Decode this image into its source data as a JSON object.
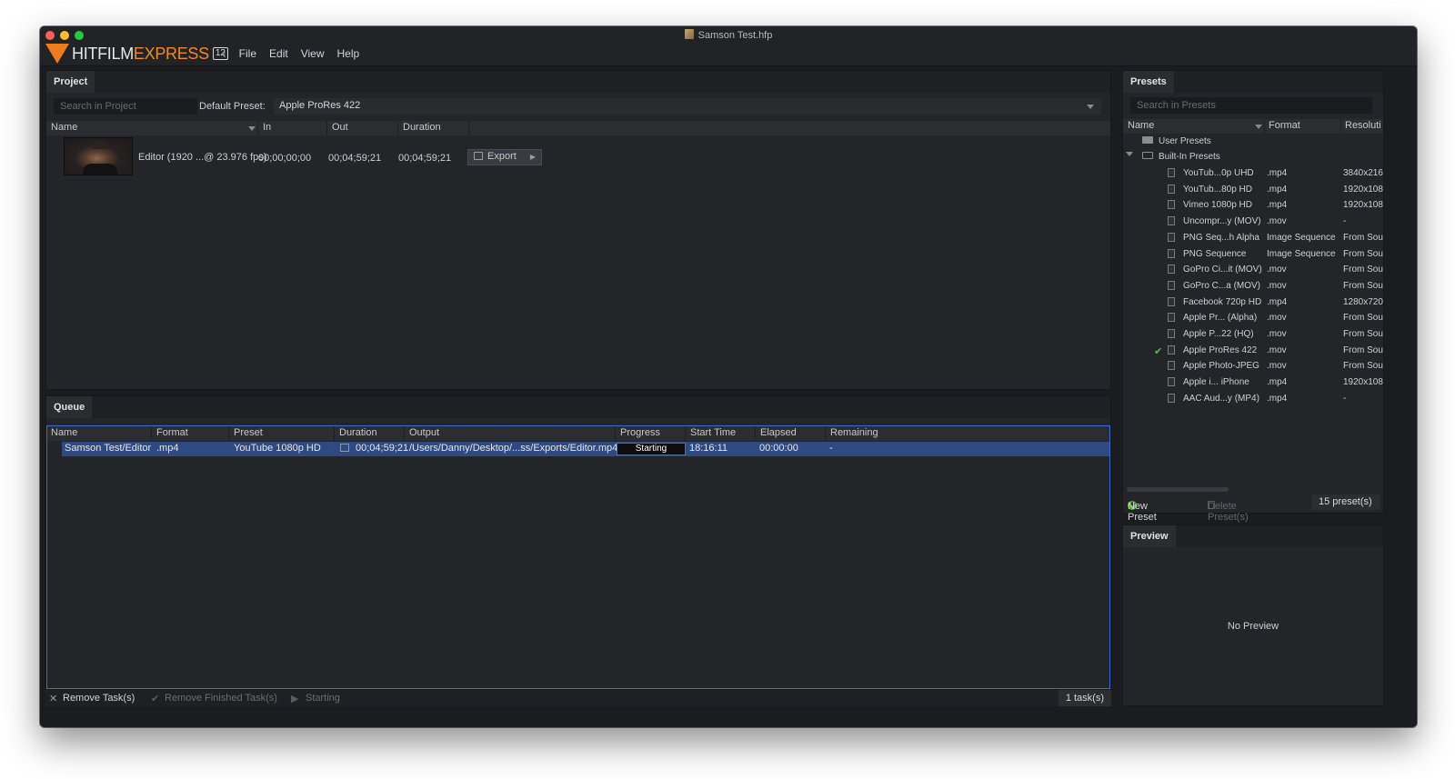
{
  "window": {
    "doc_title": "Samson Test.hfp"
  },
  "logo": {
    "hit": "HITFILM",
    "express": "EXPRESS",
    "badge": "12"
  },
  "menu": {
    "back": "‹",
    "items": [
      "File",
      "Edit",
      "View",
      "Help"
    ]
  },
  "project": {
    "tab": "Project",
    "search_placeholder": "Search in Project",
    "default_preset_label": "Default Preset:",
    "default_preset_value": "Apple ProRes 422",
    "columns": [
      "Name",
      "In",
      "Out",
      "Duration"
    ],
    "rows": [
      {
        "name": "Editor (1920 ...@ 23.976 fps)",
        "in": "00;00;00;00",
        "out": "00;04;59;21",
        "duration": "00;04;59;21",
        "action": "Export"
      }
    ]
  },
  "queue": {
    "tab": "Queue",
    "columns": [
      "Name",
      "Format",
      "Preset",
      "Duration",
      "Output",
      "Progress",
      "Start Time",
      "Elapsed",
      "Remaining"
    ],
    "rows": [
      {
        "name": "Samson Test/Editor",
        "format": ".mp4",
        "preset": "YouTube 1080p HD",
        "duration": "00;04;59;21",
        "output": "/Users/Danny/Desktop/...ss/Exports/Editor.mp4",
        "progress": "Starting",
        "start_time": "18:16:11",
        "elapsed": "00:00:00",
        "remaining": "-"
      }
    ],
    "footer": {
      "remove_tasks": "Remove Task(s)",
      "remove_finished": "Remove Finished Task(s)",
      "status": "Starting",
      "count": "1 task(s)"
    }
  },
  "presets": {
    "tab": "Presets",
    "search_placeholder": "Search in Presets",
    "columns": [
      "Name",
      "Format",
      "Resoluti"
    ],
    "user_folder": "User Presets",
    "builtin_folder": "Built-In Presets",
    "items": [
      {
        "name": "YouTub...0p UHD",
        "format": ".mp4",
        "res": "3840x216",
        "checked": false
      },
      {
        "name": "YouTub...80p HD",
        "format": ".mp4",
        "res": "1920x108",
        "checked": false
      },
      {
        "name": "Vimeo 1080p HD",
        "format": ".mp4",
        "res": "1920x108",
        "checked": false
      },
      {
        "name": "Uncompr...y (MOV)",
        "format": ".mov",
        "res": "-",
        "checked": false
      },
      {
        "name": "PNG Seq...h Alpha",
        "format": "Image Sequence",
        "res": "From Sou",
        "checked": false
      },
      {
        "name": "PNG Sequence",
        "format": "Image Sequence",
        "res": "From Sou",
        "checked": false
      },
      {
        "name": "GoPro Ci...it (MOV)",
        "format": ".mov",
        "res": "From Sou",
        "checked": false
      },
      {
        "name": "GoPro C...a (MOV)",
        "format": ".mov",
        "res": "From Sou",
        "checked": false
      },
      {
        "name": "Facebook 720p HD",
        "format": ".mp4",
        "res": "1280x720",
        "checked": false
      },
      {
        "name": "Apple Pr... (Alpha)",
        "format": ".mov",
        "res": "From Sou",
        "checked": false
      },
      {
        "name": "Apple P...22 (HQ)",
        "format": ".mov",
        "res": "From Sou",
        "checked": false
      },
      {
        "name": "Apple ProRes 422",
        "format": ".mov",
        "res": "From Sou",
        "checked": true
      },
      {
        "name": "Apple Photo-JPEG",
        "format": ".mov",
        "res": "From Sou",
        "checked": false
      },
      {
        "name": "Apple i... iPhone",
        "format": ".mp4",
        "res": "1920x108",
        "checked": false
      },
      {
        "name": "AAC Aud...y (MP4)",
        "format": ".mp4",
        "res": "-",
        "checked": false
      }
    ],
    "footer": {
      "new_preset": "New Preset",
      "delete_preset": "Delete Preset(s)",
      "count": "15 preset(s)"
    }
  },
  "preview": {
    "tab": "Preview",
    "empty_text": "No Preview"
  },
  "colors": {
    "accent": "#3a6bd0",
    "brand": "#f07a1e",
    "check": "#5fbf3a"
  }
}
